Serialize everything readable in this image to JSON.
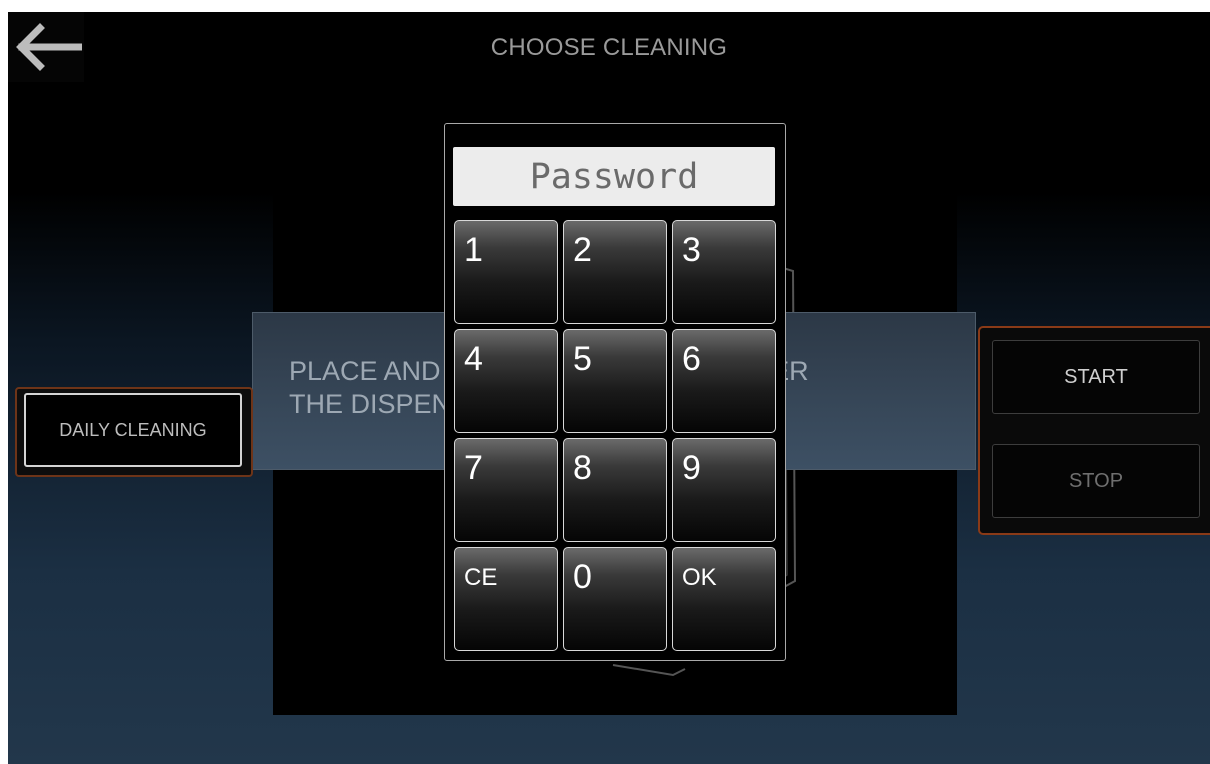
{
  "header": {
    "title": "CHOOSE CLEANING",
    "back_icon": "left-arrow-icon"
  },
  "instruction": {
    "text": "PLACE AND EMPTY CONTAINER UNDER\nTHE DISPENSER AND PUSH START"
  },
  "cleaning_options": {
    "daily_label": "DAILY CLEANING"
  },
  "controls": {
    "start_label": "START",
    "stop_label": "STOP"
  },
  "keypad": {
    "placeholder": "Password",
    "keys": [
      "1",
      "2",
      "3",
      "4",
      "5",
      "6",
      "7",
      "8",
      "9",
      "CE",
      "0",
      "OK"
    ]
  },
  "colors": {
    "selection_border": "#8a3a17",
    "background_top": "#000000",
    "background_bottom": "#22374b"
  }
}
